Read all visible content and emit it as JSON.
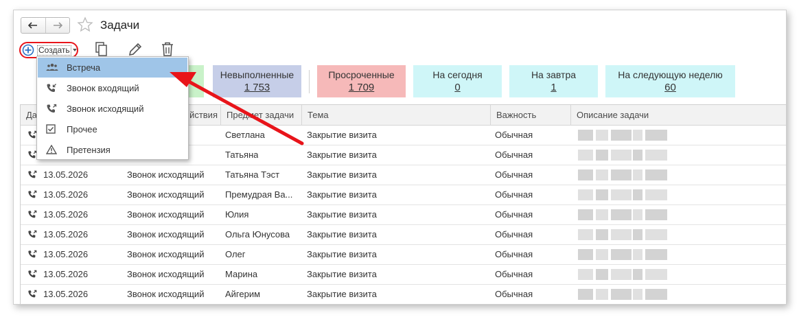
{
  "window": {
    "title": "Задачи"
  },
  "toolbar": {
    "create_label": "Создать"
  },
  "filters": [
    {
      "label": "",
      "count": "",
      "color": "#c9f2c9"
    },
    {
      "label": "Невыполненные",
      "count": "1 753",
      "color": "#c6cee8"
    },
    {
      "label": "Просроченные",
      "count": "1 709",
      "color": "#f6b9b9"
    },
    {
      "label": "На сегодня",
      "count": "0",
      "color": "#cff6f8"
    },
    {
      "label": "На завтра",
      "count": "1",
      "color": "#cff6f8"
    },
    {
      "label": "На следующую неделю",
      "count": "60",
      "color": "#cff6f8"
    }
  ],
  "table": {
    "columns": [
      "Да",
      "йствия",
      "Предмет задачи",
      "Тема",
      "Важность",
      "Описание задачи"
    ],
    "rows": [
      {
        "date": "",
        "action": "щий",
        "subject": "Светлана",
        "theme": "Закрытие визита",
        "importance": "Обычная"
      },
      {
        "date": "",
        "action": "щий",
        "subject": "Татьяна",
        "theme": "Закрытие визита",
        "importance": "Обычная"
      },
      {
        "date": "13.05.2026",
        "action": "Звонок исходящий",
        "subject": "Татьяна Тэст",
        "theme": "Закрытие визита",
        "importance": "Обычная"
      },
      {
        "date": "13.05.2026",
        "action": "Звонок исходящий",
        "subject": "Премудрая Ва...",
        "theme": "Закрытие визита",
        "importance": "Обычная"
      },
      {
        "date": "13.05.2026",
        "action": "Звонок исходящий",
        "subject": "Юлия",
        "theme": "Закрытие визита",
        "importance": "Обычная"
      },
      {
        "date": "13.05.2026",
        "action": "Звонок исходящий",
        "subject": "Ольга Юнусова",
        "theme": "Закрытие визита",
        "importance": "Обычная"
      },
      {
        "date": "13.05.2026",
        "action": "Звонок исходящий",
        "subject": "Олег",
        "theme": "Закрытие визита",
        "importance": "Обычная"
      },
      {
        "date": "13.05.2026",
        "action": "Звонок исходящий",
        "subject": "Марина",
        "theme": "Закрытие визита",
        "importance": "Обычная"
      },
      {
        "date": "13.05.2026",
        "action": "Звонок исходящий",
        "subject": "Айгерим",
        "theme": "Закрытие визита",
        "importance": "Обычная"
      }
    ]
  },
  "dropdown": {
    "items": [
      {
        "label": "Встреча",
        "icon": "people-icon",
        "selected": true
      },
      {
        "label": "Звонок входящий",
        "icon": "phone-incoming-icon",
        "selected": false
      },
      {
        "label": "Звонок исходящий",
        "icon": "phone-outgoing-icon",
        "selected": false
      },
      {
        "label": "Прочее",
        "icon": "checkbox-icon",
        "selected": false
      },
      {
        "label": "Претензия",
        "icon": "warning-icon",
        "selected": false
      }
    ]
  },
  "colors": {
    "highlight": "#e8141a",
    "selection": "#9fc5e8"
  }
}
